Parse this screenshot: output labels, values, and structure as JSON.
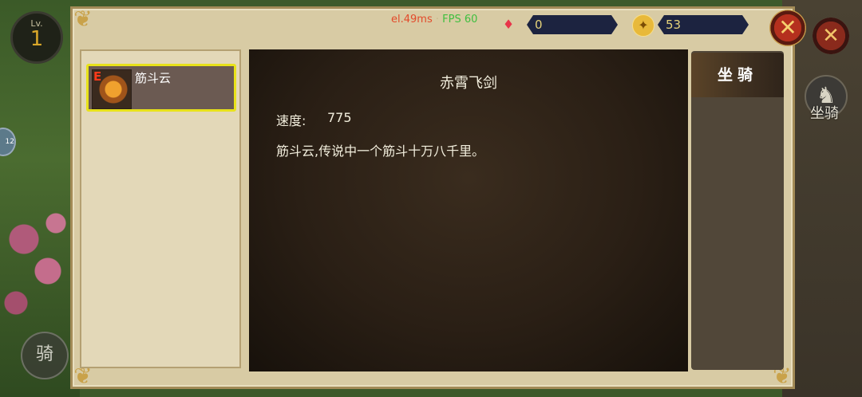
{
  "hud": {
    "level_label": "Lv.",
    "level_value": "1",
    "side_badge": "12",
    "ride_button": "骑",
    "mount_button_label": "坐骑"
  },
  "perf": {
    "ms": "el.49ms",
    "separator": " · ",
    "fps": "FPS 60"
  },
  "resources": {
    "gems": "0",
    "gold": "53"
  },
  "item_list": [
    {
      "tier": "E",
      "name": "筋斗云",
      "selected": true
    }
  ],
  "detail": {
    "title": "赤霄飞剑",
    "speed_label": "速度:",
    "speed_value": "775",
    "description": "筋斗云,传说中一个筋斗十万八千里。"
  },
  "tabs": [
    {
      "label": "坐骑",
      "active": true
    }
  ],
  "colors": {
    "highlight_border": "#e8e21a",
    "tier_color": "#ff3a1a",
    "fps_green": "#3fbf3f",
    "ms_red": "#e34a2a"
  }
}
